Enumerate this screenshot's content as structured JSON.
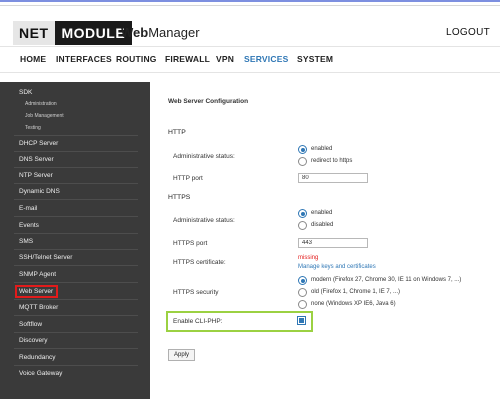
{
  "header": {
    "logo_net": "NET",
    "logo_module": "MODULE",
    "app_title_bold": "Web",
    "app_title_rest": "Manager",
    "logout": "LOGOUT"
  },
  "nav": {
    "items": [
      {
        "label": "HOME"
      },
      {
        "label": "INTERFACES"
      },
      {
        "label": "ROUTING"
      },
      {
        "label": "FIREWALL"
      },
      {
        "label": "VPN"
      },
      {
        "label": "SERVICES"
      },
      {
        "label": "SYSTEM"
      }
    ],
    "active": "SERVICES"
  },
  "sidebar": {
    "items": [
      {
        "label": "SDK"
      },
      {
        "label": "Administration"
      },
      {
        "label": "Job Management"
      },
      {
        "label": "Testing"
      },
      {
        "label": "DHCP Server"
      },
      {
        "label": "DNS Server"
      },
      {
        "label": "NTP Server"
      },
      {
        "label": "Dynamic DNS"
      },
      {
        "label": "E-mail"
      },
      {
        "label": "Events"
      },
      {
        "label": "SMS"
      },
      {
        "label": "SSH/Telnet Server"
      },
      {
        "label": "SNMP Agent"
      },
      {
        "label": "Web Server"
      },
      {
        "label": "MQTT Broker"
      },
      {
        "label": "Softflow"
      },
      {
        "label": "Discovery"
      },
      {
        "label": "Redundancy"
      },
      {
        "label": "Voice Gateway"
      }
    ],
    "selected": "Web Server"
  },
  "content": {
    "title": "Web Server Configuration",
    "http": {
      "section": "HTTP",
      "admin_label": "Administrative status:",
      "opt_enabled": "enabled",
      "opt_redirect": "redirect to https",
      "selected": "enabled",
      "port_label": "HTTP port",
      "port_value": "80"
    },
    "https": {
      "section": "HTTPS",
      "admin_label": "Administrative status:",
      "opt_enabled": "enabled",
      "opt_disabled": "disabled",
      "selected": "enabled",
      "port_label": "HTTPS port",
      "port_value": "443",
      "cert_label": "HTTPS certificate:",
      "cert_status": "missing",
      "cert_link": "Manage keys and certificates",
      "security_label": "HTTPS security",
      "sec_modern": "modern (Firefox 27, Chrome 30, IE 11 on Windows 7, ...)",
      "sec_old": "old (Firefox 1, Chrome 1, IE 7, ...)",
      "sec_none": "none (Windows XP IE6, Java 6)",
      "sec_selected": "modern"
    },
    "cli_php_label": "Enable CLI-PHP:",
    "cli_php_checked": true,
    "apply": "Apply"
  },
  "colors": {
    "accent": "#2f77b5",
    "sidebar_bg": "#3a3a3a",
    "selection_outline": "#e21b1b",
    "cli_outline": "#9bd142",
    "error": "#e21b1b"
  }
}
